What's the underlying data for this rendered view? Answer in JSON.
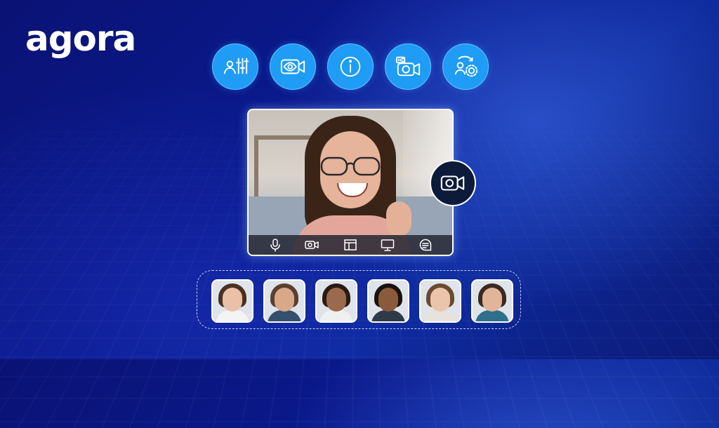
{
  "brand": {
    "logo_text": "agora"
  },
  "features": [
    {
      "icon": "user-settings-sliders-icon"
    },
    {
      "icon": "eye-camera-icon"
    },
    {
      "icon": "info-icon"
    },
    {
      "icon": "hd-camera-icon"
    },
    {
      "icon": "user-switch-settings-icon"
    }
  ],
  "video_controls": [
    {
      "icon": "microphone-icon"
    },
    {
      "icon": "camera-icon"
    },
    {
      "icon": "layout-icon"
    },
    {
      "icon": "screen-share-icon"
    },
    {
      "icon": "chat-icon"
    }
  ],
  "camera_badge": {
    "icon": "video-camera-icon"
  },
  "participants": [
    {
      "name": "participant-1"
    },
    {
      "name": "participant-2"
    },
    {
      "name": "participant-3"
    },
    {
      "name": "participant-4"
    },
    {
      "name": "participant-5"
    },
    {
      "name": "participant-6"
    }
  ],
  "colors": {
    "accent": "#1f9cf5",
    "background": "#0a1a8e",
    "white": "#ffffff"
  }
}
